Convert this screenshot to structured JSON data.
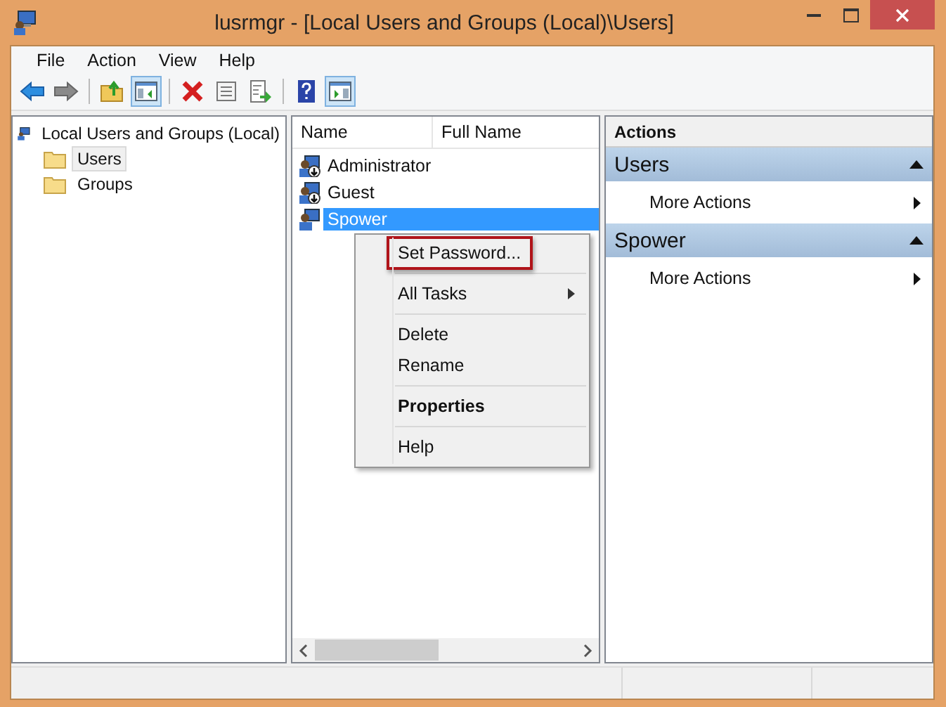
{
  "window": {
    "title": "lusrmgr - [Local Users and Groups (Local)\\Users]"
  },
  "menu": [
    "File",
    "Action",
    "View",
    "Help"
  ],
  "toolbar": [
    {
      "kind": "back",
      "pressed": false
    },
    {
      "kind": "forward",
      "pressed": false
    },
    {
      "kind": "sep"
    },
    {
      "kind": "up",
      "pressed": false
    },
    {
      "kind": "tree",
      "pressed": true
    },
    {
      "kind": "sep"
    },
    {
      "kind": "delete",
      "pressed": false
    },
    {
      "kind": "properties",
      "pressed": false
    },
    {
      "kind": "export",
      "pressed": false
    },
    {
      "kind": "sep"
    },
    {
      "kind": "help",
      "pressed": false
    },
    {
      "kind": "actionpane",
      "pressed": true
    }
  ],
  "tree": [
    {
      "label": "Local Users and Groups (Local)",
      "kind": "computer",
      "selected": false,
      "children": [
        {
          "label": "Users",
          "kind": "folder",
          "selected": true
        },
        {
          "label": "Groups",
          "kind": "folder",
          "selected": false
        }
      ]
    }
  ],
  "list": {
    "columns": [
      "Name",
      "Full Name"
    ],
    "rows": [
      {
        "name": "Administrator",
        "kind": "disabled-user",
        "selected": false
      },
      {
        "name": "Guest",
        "kind": "disabled-user",
        "selected": false
      },
      {
        "name": "Spower",
        "kind": "user",
        "selected": true
      }
    ]
  },
  "context_menu": [
    {
      "kind": "item",
      "label": "Set Password...",
      "highlighted": true,
      "bold": false,
      "submenu": false
    },
    {
      "kind": "separator"
    },
    {
      "kind": "item",
      "label": "All Tasks",
      "highlighted": false,
      "bold": false,
      "submenu": true
    },
    {
      "kind": "separator"
    },
    {
      "kind": "item",
      "label": "Delete",
      "highlighted": false,
      "bold": false,
      "submenu": false
    },
    {
      "kind": "item",
      "label": "Rename",
      "highlighted": false,
      "bold": false,
      "submenu": false
    },
    {
      "kind": "separator"
    },
    {
      "kind": "item",
      "label": "Properties",
      "highlighted": false,
      "bold": true,
      "submenu": false
    },
    {
      "kind": "separator"
    },
    {
      "kind": "item",
      "label": "Help",
      "highlighted": false,
      "bold": false,
      "submenu": false
    }
  ],
  "actions": {
    "header": "Actions",
    "sections": [
      {
        "title": "Users",
        "expanded": true,
        "items": [
          {
            "label": "More Actions",
            "submenu": true
          }
        ]
      },
      {
        "title": "Spower",
        "expanded": true,
        "items": [
          {
            "label": "More Actions",
            "submenu": true
          }
        ]
      }
    ]
  }
}
